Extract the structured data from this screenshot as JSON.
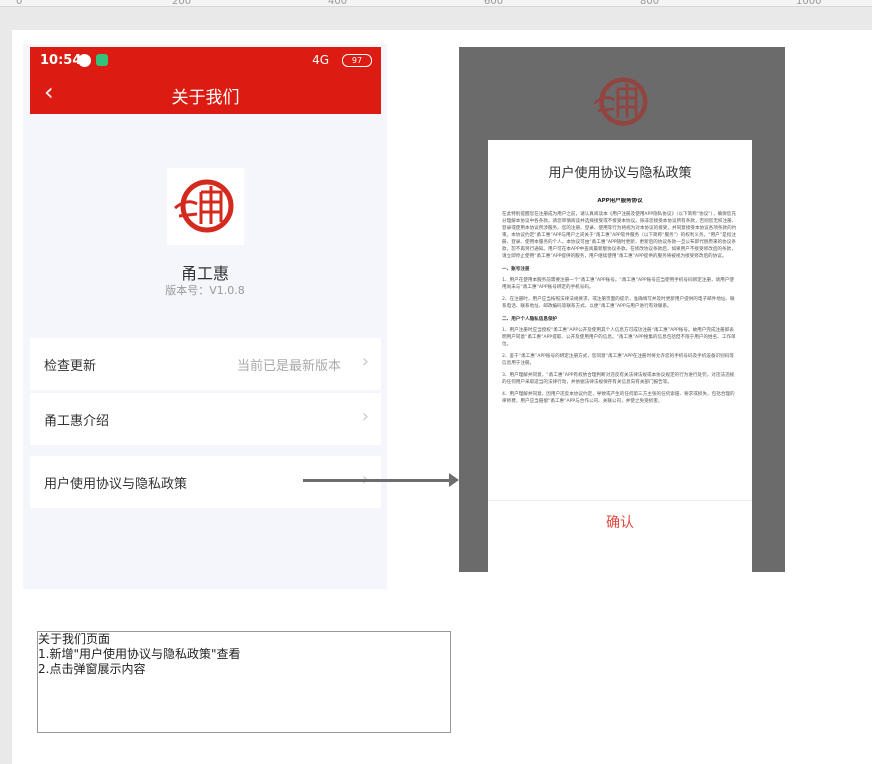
{
  "ruler": {
    "ticks": [
      "0",
      "200",
      "400",
      "600",
      "800",
      "1000"
    ]
  },
  "phone": {
    "status": {
      "time": "10:54",
      "network": "4G",
      "battery": "97"
    },
    "nav": {
      "back_icon": "chevron-left-icon",
      "title": "关于我们"
    },
    "app": {
      "name": "甬工惠",
      "version": "版本号：V1.0.8"
    },
    "rows": [
      {
        "label": "检查更新",
        "value": "当前已是最新版本"
      },
      {
        "label": "甬工惠介绍",
        "value": ""
      },
      {
        "label": "用户使用协议与隐私政策",
        "value": ""
      }
    ],
    "chevron": "›"
  },
  "modal": {
    "title": "用户使用协议与隐私政策",
    "heading": "APP用户服务协议",
    "intro": "在此特别提醒您在注册成为用户之前，请认真阅读本《用户注册及使用APP隐私协议》（以下简称“协议”），确保您充分理解本协议中各条款。请您审慎阅读并选择接受或不接受本协议。除非您接受本协议所有条款，否则您无权注册、登录或使用本协议所涉服务。您的注册、登录、使用等行为将视为对本协议的接受，并同意接受本协议各项条款的约束。本协议约定“甬工惠”APP与用户之间关于“甬工惠”APP软件服务（以下简称“服务”）的权利义务。“用户”是指注册、登录、使用本服务的个人。本协议可由“甬工惠”APP随时更新，更新后的协议条款一旦公布即代替原来的协议条款，恕不再另行通知。用户可在本APP中查阅最新版协议条款。在修改协议条款后，如果用户不接受修改后的条款，请立即停止使用“甬工惠”APP提供的服务，用户继续使用“甬工惠”APP提供的服务将被视为接受修改后的协议。",
    "section1": "一、账号注册",
    "p1": "1、用户在使用本服务前需要注册一个“甬工惠”APP账号。“甬工惠”APP账号应当使用手机号码绑定注册，请用户使用尚未与“甬工惠”APP账号绑定的手机号码。",
    "p2": "2、在注册时，用户应当按照法律法规要求，或注册页面的提示，准确填写并及时更新用户提供的电子邮件地址、联系电话、联系地址、邮政编码等联系方式，以便“甬工惠”APP与用户进行有效联系。",
    "section2": "二、用户个人隐私信息保护",
    "p3": "1、用户注册时应当授权“甬工惠”APP公开及使用其个人信息方可成功注册“甬工惠”APP账号。故用户完成注册即表明用户同意“甬工惠”APP提取、公开及使用用户的信息。“甬工惠”APP搜集的信息包括但不限于用户的姓名、工作单位。",
    "p4": "2、鉴于“甬工惠”APP账号的绑定注册方式，您同意“甬工惠”APP在注册时将允许您的手机号码及手机设备识别码等信息用于注册。",
    "p5": "3、用户理解并同意，“甬工惠”APP有权依合理判断对违反有关法律法规或本协议规定的行为进行处罚，对违法违规的任何用户采取适当的法律行动，并依据法律法规保存有关信息向有关部门报告等。",
    "p6": "4、用户理解并同意，因用户违反本协议约定，导致或产生的任何第三方主张的任何索赔、要求或损失，包括合理的律师费，用户应当赔偿“甬工惠”APP与合作公司、关联公司，并使之免受损害。",
    "confirm": "确认"
  },
  "note": {
    "line1": "关于我们页面",
    "line2": "1.新增\"用户使用协议与隐私政策\"查看",
    "line3": "2.点击弹窗展示内容"
  },
  "colors": {
    "brand_red": "#dc1c12",
    "overlay": "#6b6b6b",
    "confirm": "#e2493f"
  }
}
